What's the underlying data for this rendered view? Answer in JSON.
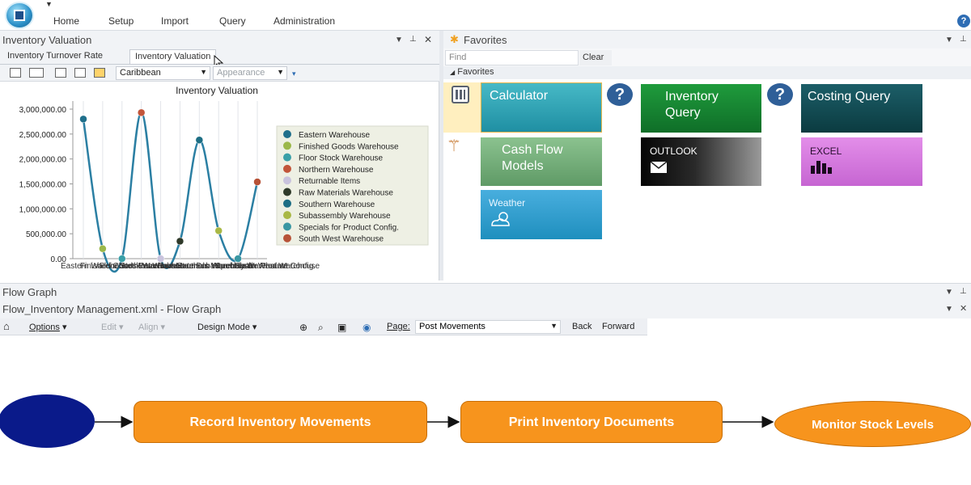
{
  "menu": [
    "Home",
    "Setup",
    "Import",
    "Query",
    "Administration"
  ],
  "inventory_pane": {
    "title": "Inventory Valuation",
    "tabs": [
      "Inventory Turnover Rate",
      "Inventory Valuation"
    ],
    "theme_value": "Caribbean",
    "appearance_label": "Appearance"
  },
  "chart_data": {
    "type": "line",
    "title": "Inventory Valuation",
    "y_ticks": [
      "3,000,000.00",
      "2,500,000.00",
      "2,000,000.00",
      "1,500,000.00",
      "1,000,000.00",
      "500,000.00",
      "0.00"
    ],
    "ylim": [
      0,
      3200000
    ],
    "x_label_visible": "Warehouse",
    "categories": [
      "Eastern Warehouse",
      "Finished Goods Warehouse",
      "Floor Stock Warehouse",
      "Northern Warehouse",
      "Returnable Items",
      "Raw Materials Warehouse",
      "Southern Warehouse",
      "Subassembly Warehouse",
      "Specials for Product Config.",
      "South West Warehouse"
    ],
    "values": [
      2800000,
      200000,
      0,
      2930000,
      0,
      350000,
      2380000,
      560000,
      0,
      1540000
    ],
    "point_colors": [
      "#1f6f8b",
      "#9bb84a",
      "#3aa0a8",
      "#c2553a",
      "#c9c3dd",
      "#2f3a2a",
      "#1d6e84",
      "#a9b845",
      "#3a97a3",
      "#b75237"
    ],
    "line_color": "#2b7fa3",
    "legend_position": "right"
  },
  "favorites": {
    "title": "Favorites",
    "find_placeholder": "Find",
    "clear_label": "Clear",
    "group_label": "Favorites",
    "tiles": {
      "calculator": "Calculator",
      "inventory_query": "Inventory Query",
      "costing_query": "Costing Query",
      "cash_flow": "Cash Flow Models",
      "outlook": "OUTLOOK",
      "excel": "EXCEL",
      "weather": "Weather"
    },
    "help_badge": "?"
  },
  "flow": {
    "pane_title": "Flow Graph",
    "doc_title": "Flow_Inventory Management.xml - Flow Graph",
    "toolbar": {
      "options": "Options",
      "edit": "Edit",
      "align": "Align",
      "design_mode": "Design Mode",
      "page_label": "Page:",
      "page_value": "Post Movements",
      "back": "Back",
      "forward": "Forward"
    },
    "nodes": [
      "Record Inventory Movements",
      "Print Inventory Documents",
      "Monitor Stock Levels"
    ]
  },
  "icons": [
    "app-logo-icon",
    "help-icon",
    "pin-icon",
    "close-icon",
    "star-icon",
    "calculator-icon",
    "magic-wand-icon",
    "mail-icon",
    "bar-chart-icon",
    "weather-icon",
    "home-icon"
  ]
}
